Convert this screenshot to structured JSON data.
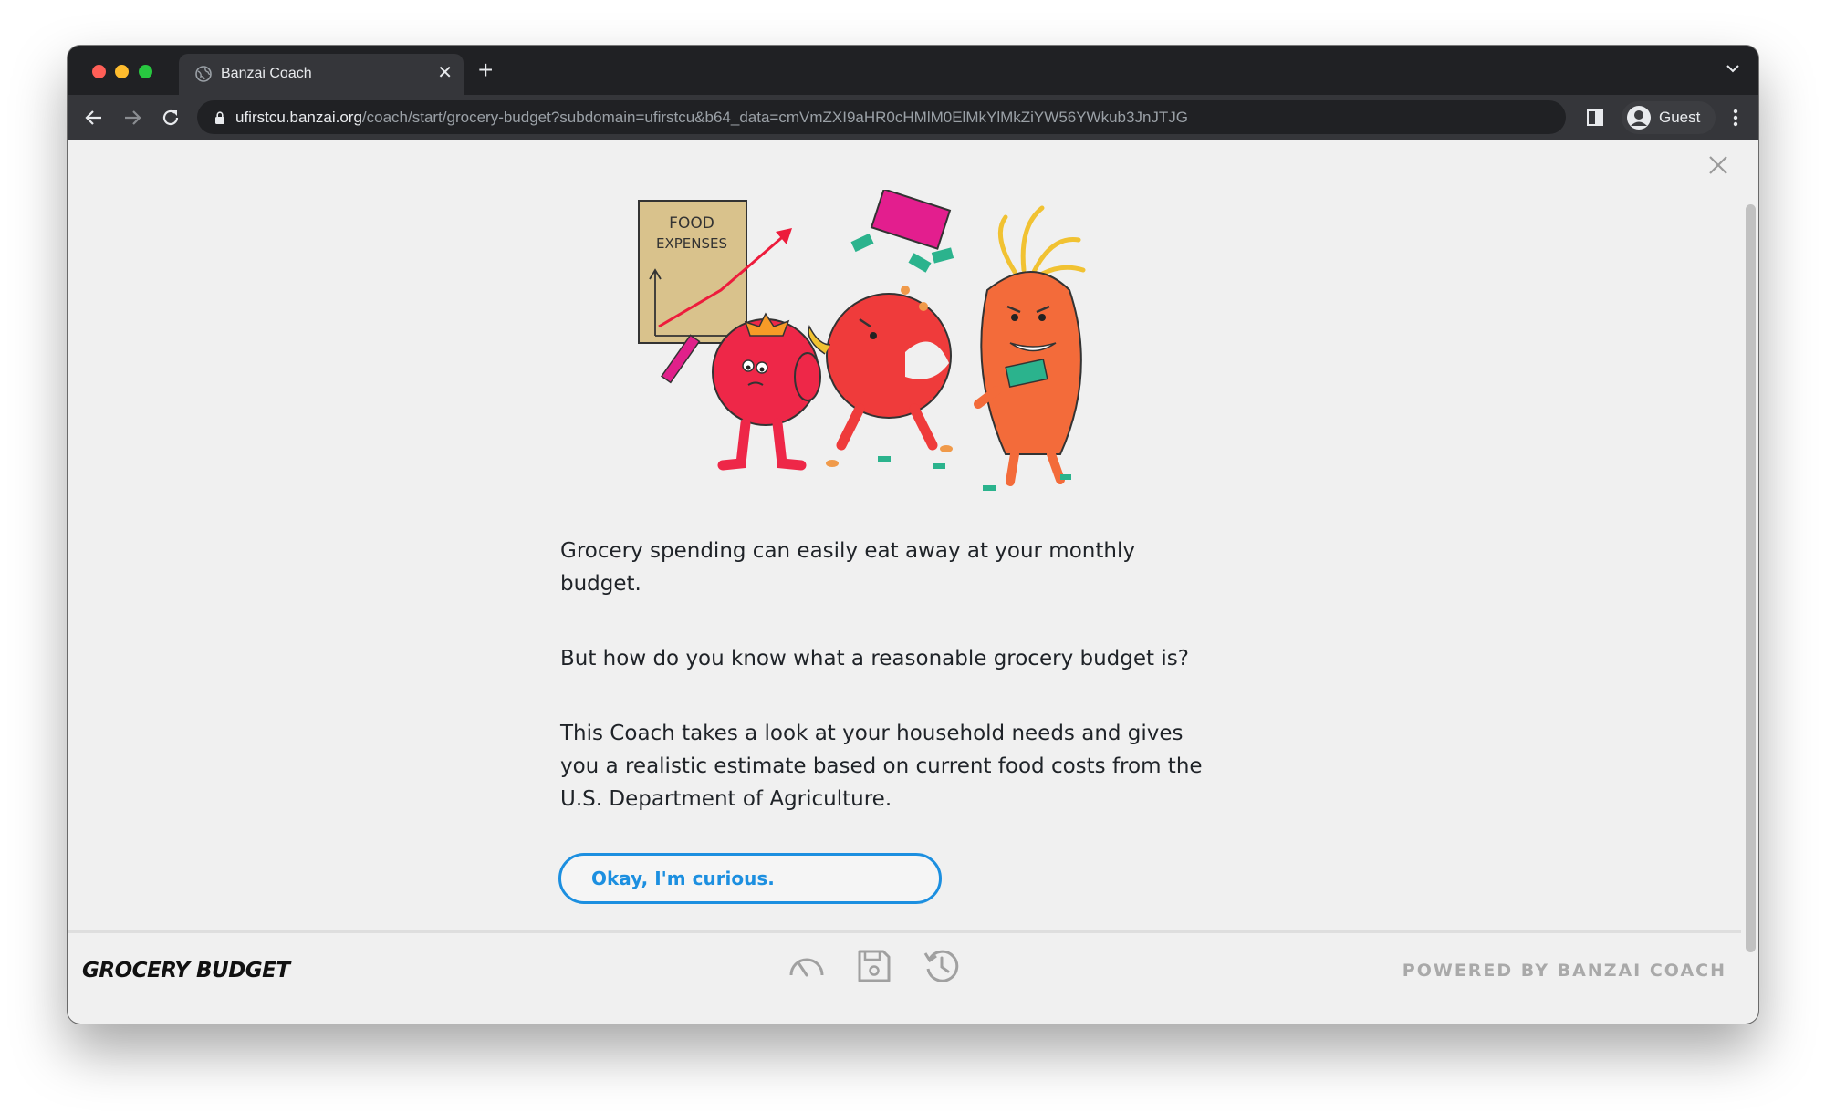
{
  "browser": {
    "tab_title": "Banzai Coach",
    "url_host": "ufirstcu.banzai.org",
    "url_path": "/coach/start/grocery-budget?subdomain=ufirstcu&b64_data=cmVmZXI9aHR0cHMlM0ElMkYlMkZiYW56YWkub3JnJTJG",
    "profile_label": "Guest"
  },
  "illustration": {
    "sign_line1": "FOOD",
    "sign_line2": "EXPENSES"
  },
  "content": {
    "paragraph_1": "Grocery spending can easily eat away at your monthly budget.",
    "paragraph_2": "But how do you know what a reasonable grocery budget is?",
    "paragraph_3": "This Coach takes a look at your household needs and gives you a realistic estimate based on current food costs from the U.S. Department of Agriculture.",
    "cta_label": "Okay, I'm curious."
  },
  "footer": {
    "title": "GROCERY BUDGET",
    "powered_by": "POWERED BY BANZAI COACH",
    "icons": [
      "speedometer-icon",
      "save-icon",
      "history-icon"
    ]
  },
  "colors": {
    "accent": "#1c8fe0",
    "page_bg": "#f0f0f0",
    "browser_dark": "#202124"
  }
}
